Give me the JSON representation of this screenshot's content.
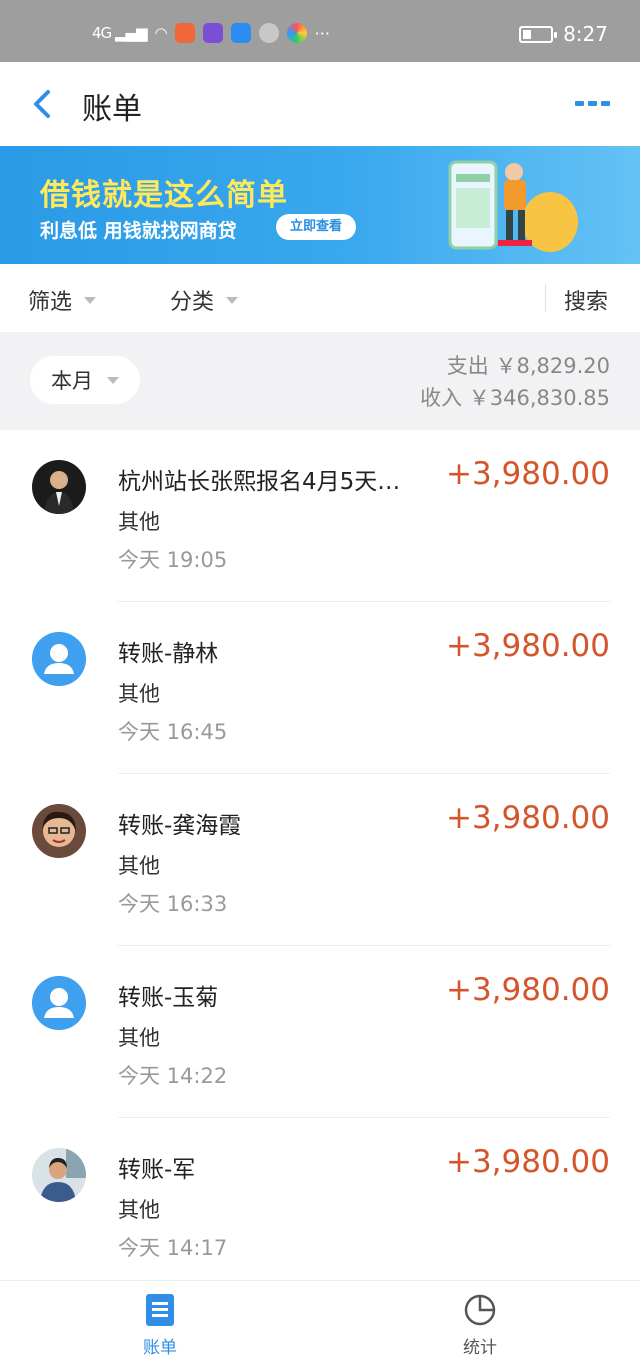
{
  "status_bar": {
    "network": "4G",
    "time": "8:27",
    "more": "···",
    "battery_level": 0.3,
    "app_icons": [
      "cast-app-icon",
      "purple-app-icon",
      "blue-app-icon",
      "settings-app-icon",
      "color-app-icon"
    ]
  },
  "nav": {
    "title": "账单",
    "back_icon": "chevron-left-icon",
    "more_icon": "more-dots-icon"
  },
  "banner": {
    "title": "借钱就是这么简单",
    "subtitle": "利息低 用钱就找网商贷",
    "button_label": "立即查看"
  },
  "filters": {
    "filter_label": "筛选",
    "category_label": "分类",
    "search_label": "搜索"
  },
  "summary": {
    "period_label": "本月",
    "expense": "支出 ￥8,829.20",
    "income": "收入 ￥346,830.85"
  },
  "transactions": [
    {
      "title": "杭州站长张熙报名4月5天…",
      "category": "其他",
      "time": "今天  19:05",
      "amount": "+3,980.00",
      "avatar": "photo-man-suit"
    },
    {
      "title": "转账-静林",
      "category": "其他",
      "time": "今天  16:45",
      "amount": "+3,980.00",
      "avatar": "default"
    },
    {
      "title": "转账-龚海霞",
      "category": "其他",
      "time": "今天  16:33",
      "amount": "+3,980.00",
      "avatar": "photo-woman-glasses"
    },
    {
      "title": "转账-玉菊",
      "category": "其他",
      "time": "今天  14:22",
      "amount": "+3,980.00",
      "avatar": "default"
    },
    {
      "title": "转账-军",
      "category": "其他",
      "time": "今天  14:17",
      "amount": "+3,980.00",
      "avatar": "photo-man-office"
    }
  ],
  "tabs": {
    "bill_label": "账单",
    "stats_label": "统计"
  },
  "colors": {
    "accent": "#2f8ee6",
    "amount": "#d4552b",
    "banner_title": "#ffe95a",
    "status_bar": "#9e9e9e"
  }
}
